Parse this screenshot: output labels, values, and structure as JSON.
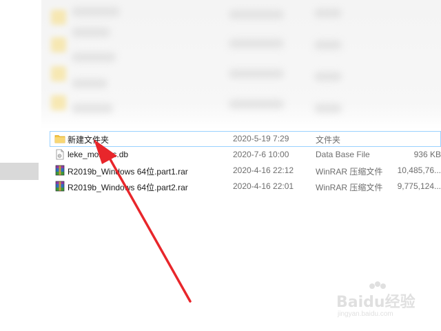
{
  "files": [
    {
      "name": "新建文件夹",
      "date": "2020-5-19 7:29",
      "type": "文件夹",
      "size": "",
      "icon": "folder-icon"
    },
    {
      "name": "leke_mobpos.db",
      "date": "2020-7-6 10:00",
      "type": "Data Base File",
      "size": "936 KB",
      "icon": "db-file-icon"
    },
    {
      "name": "R2019b_Windows 64位.part1.rar",
      "date": "2020-4-16 22:12",
      "type": "WinRAR 压缩文件",
      "size": "10,485,76...",
      "icon": "winrar-icon"
    },
    {
      "name": "R2019b_Windows 64位.part2.rar",
      "date": "2020-4-16 22:01",
      "type": "WinRAR 压缩文件",
      "size": "9,775,124...",
      "icon": "winrar-icon"
    }
  ],
  "watermark": {
    "brand": "Baidu经验",
    "url": "jingyan.baidu.com"
  },
  "colors": {
    "selection_border": "#99d1ff",
    "arrow": "#e8262b",
    "folder": "#f5c542",
    "pane_highlight": "#d9d9d9"
  }
}
